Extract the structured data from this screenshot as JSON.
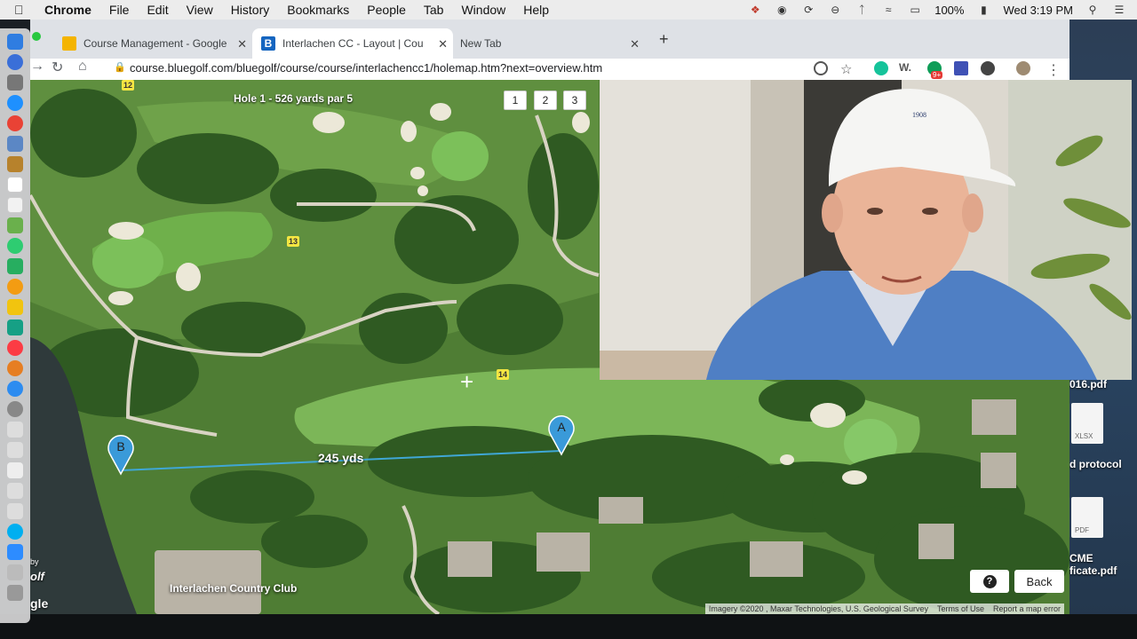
{
  "menubar": {
    "app": "Chrome",
    "items": [
      "File",
      "Edit",
      "View",
      "History",
      "Bookmarks",
      "People",
      "Tab",
      "Window",
      "Help"
    ],
    "battery": "100%",
    "clock": "Wed 3:19 PM"
  },
  "tabs": [
    {
      "label": "Course Management - Google",
      "icon": "google-slides-icon",
      "active": false
    },
    {
      "label": "Interlachen CC - Layout | Cou",
      "icon": "bluegolf-icon",
      "active": true
    },
    {
      "label": "New Tab",
      "icon": "",
      "active": false
    }
  ],
  "toolbar": {
    "url_host": "course.bluegolf.com",
    "url_path": "/bluegolf/course/course/interlachencc1/holemap.htm?next=overview.htm",
    "ext_badge": "9+"
  },
  "map": {
    "hole_title": "Hole 1 - 526 yards par 5",
    "hole_buttons": [
      "1",
      "2",
      "3"
    ],
    "hole_markers": [
      "12",
      "13",
      "14"
    ],
    "marker_a": "A",
    "marker_b": "B",
    "distance": "245 yds",
    "club_label": "Interlachen Country Club",
    "logo_by": "by",
    "logo_olf": "olf",
    "logo_gle": "gle",
    "back_label": "Back",
    "help_label": "?",
    "attribution": [
      "Imagery ©2020 , Maxar Technologies, U.S. Geological Survey",
      "Terms of Use",
      "Report a map error"
    ]
  },
  "desktop": {
    "files": [
      {
        "label": "016.pdf"
      },
      {
        "label": "d protocol",
        "type": "XLSX"
      },
      {
        "label": "CME",
        "type": "PDF"
      },
      {
        "label": "ficate.pdf"
      }
    ]
  },
  "webcam": {
    "cap_text": "1908"
  }
}
